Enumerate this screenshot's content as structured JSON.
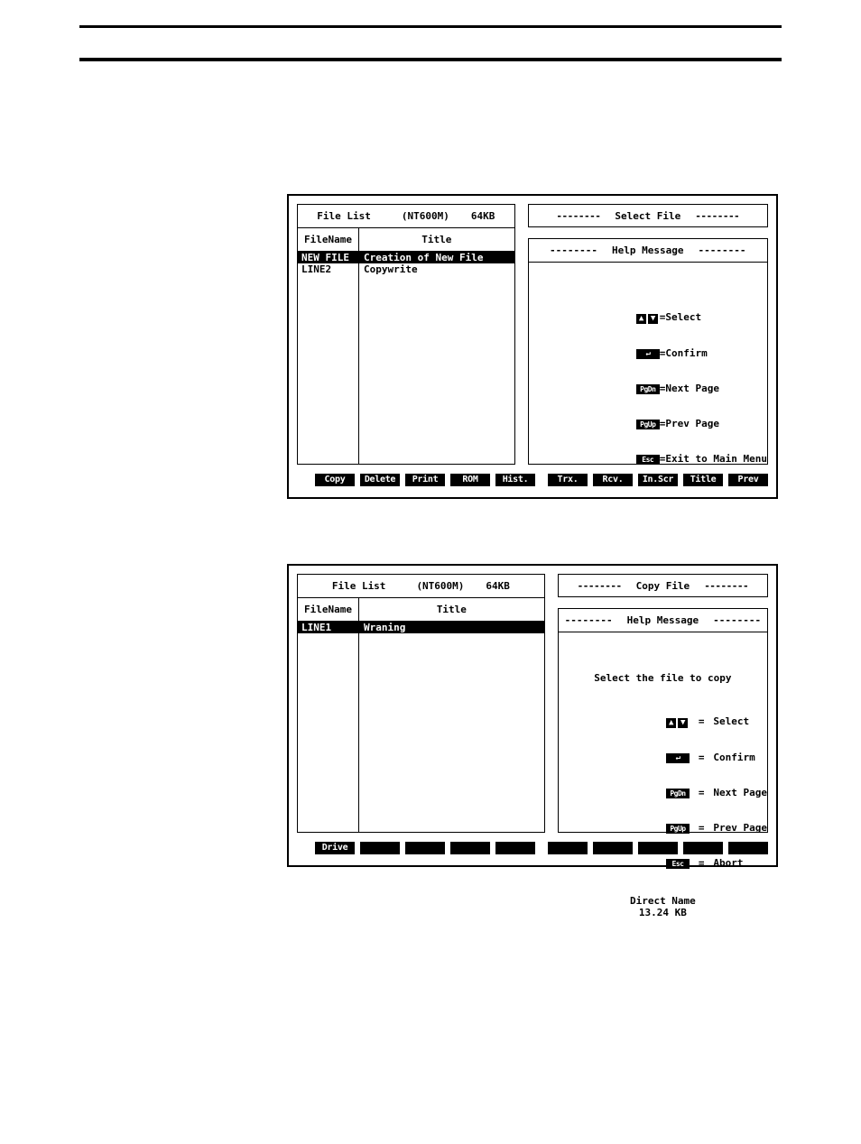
{
  "figures": [
    {
      "id": "select-file-screen",
      "file_list": {
        "header": {
          "title": "File List",
          "model": "(NT600M)",
          "memory": "64KB"
        },
        "columns": {
          "name": "FileName",
          "title": "Title"
        },
        "rows": [
          {
            "name": "NEW FILE",
            "title": "Creation of New File",
            "selected": true
          },
          {
            "name": "LINE2",
            "title": "Copywrite",
            "selected": false
          }
        ]
      },
      "mode_box": {
        "dash_left": "--------",
        "label": "Select File",
        "dash_right": "--------"
      },
      "help": {
        "dash_left": "--------",
        "title": "Help Message",
        "dash_right": "--------",
        "prompt": "",
        "keys": [
          {
            "cap": "arrows",
            "cap_text": "",
            "eq": "=",
            "desc": "Select"
          },
          {
            "cap": "enter",
            "cap_text": "↵",
            "eq": "=",
            "desc": "Confirm"
          },
          {
            "cap": "pgdn",
            "cap_text": "PgDn",
            "eq": "=",
            "desc": "Next Page"
          },
          {
            "cap": "pgup",
            "cap_text": "PgUp",
            "eq": "=",
            "desc": "Prev Page"
          },
          {
            "cap": "esc",
            "cap_text": "Esc",
            "eq": "=",
            "desc": "Exit to Main Menu"
          }
        ],
        "footer_line1": "",
        "footer_line2": ""
      },
      "fkeys_left": [
        "Copy",
        "Delete",
        "Print",
        "ROM",
        "Hist."
      ],
      "fkeys_right": [
        "Trx.",
        "Rcv.",
        "In.Scr",
        "Title",
        "Prev"
      ]
    },
    {
      "id": "copy-file-screen",
      "file_list": {
        "header": {
          "title": "File List",
          "model": "(NT600M)",
          "memory": "64KB"
        },
        "columns": {
          "name": "FileName",
          "title": "Title"
        },
        "rows": [
          {
            "name": "LINE1",
            "title": "Wraning",
            "selected": true
          }
        ]
      },
      "mode_box": {
        "dash_left": "--------",
        "label": "Copy File",
        "dash_right": "--------"
      },
      "help": {
        "dash_left": "--------",
        "title": "Help Message",
        "dash_right": "--------",
        "prompt": "Select the file to copy",
        "keys": [
          {
            "cap": "arrows",
            "cap_text": "",
            "eq": "=",
            "desc": "Select"
          },
          {
            "cap": "enter",
            "cap_text": "↵",
            "eq": "=",
            "desc": "Confirm"
          },
          {
            "cap": "pgdn",
            "cap_text": "PgDn",
            "eq": "=",
            "desc": "Next Page"
          },
          {
            "cap": "pgup",
            "cap_text": "PgUp",
            "eq": "=",
            "desc": "Prev Page"
          },
          {
            "cap": "esc",
            "cap_text": "Esc",
            "eq": "=",
            "desc": "Abort"
          }
        ],
        "footer_line1": "Direct Name",
        "footer_line2": "13.24 KB"
      },
      "fkeys_left": [
        "Drive",
        "",
        "",
        "",
        ""
      ],
      "fkeys_right": [
        "",
        "",
        "",
        "",
        ""
      ]
    }
  ],
  "icons": {
    "arrow_up": "↑",
    "arrow_down": "↓",
    "enter_key": "↵"
  },
  "colors": {
    "background": "#ffffff",
    "foreground": "#000000",
    "highlight_bg": "#000000",
    "highlight_fg": "#ffffff"
  }
}
